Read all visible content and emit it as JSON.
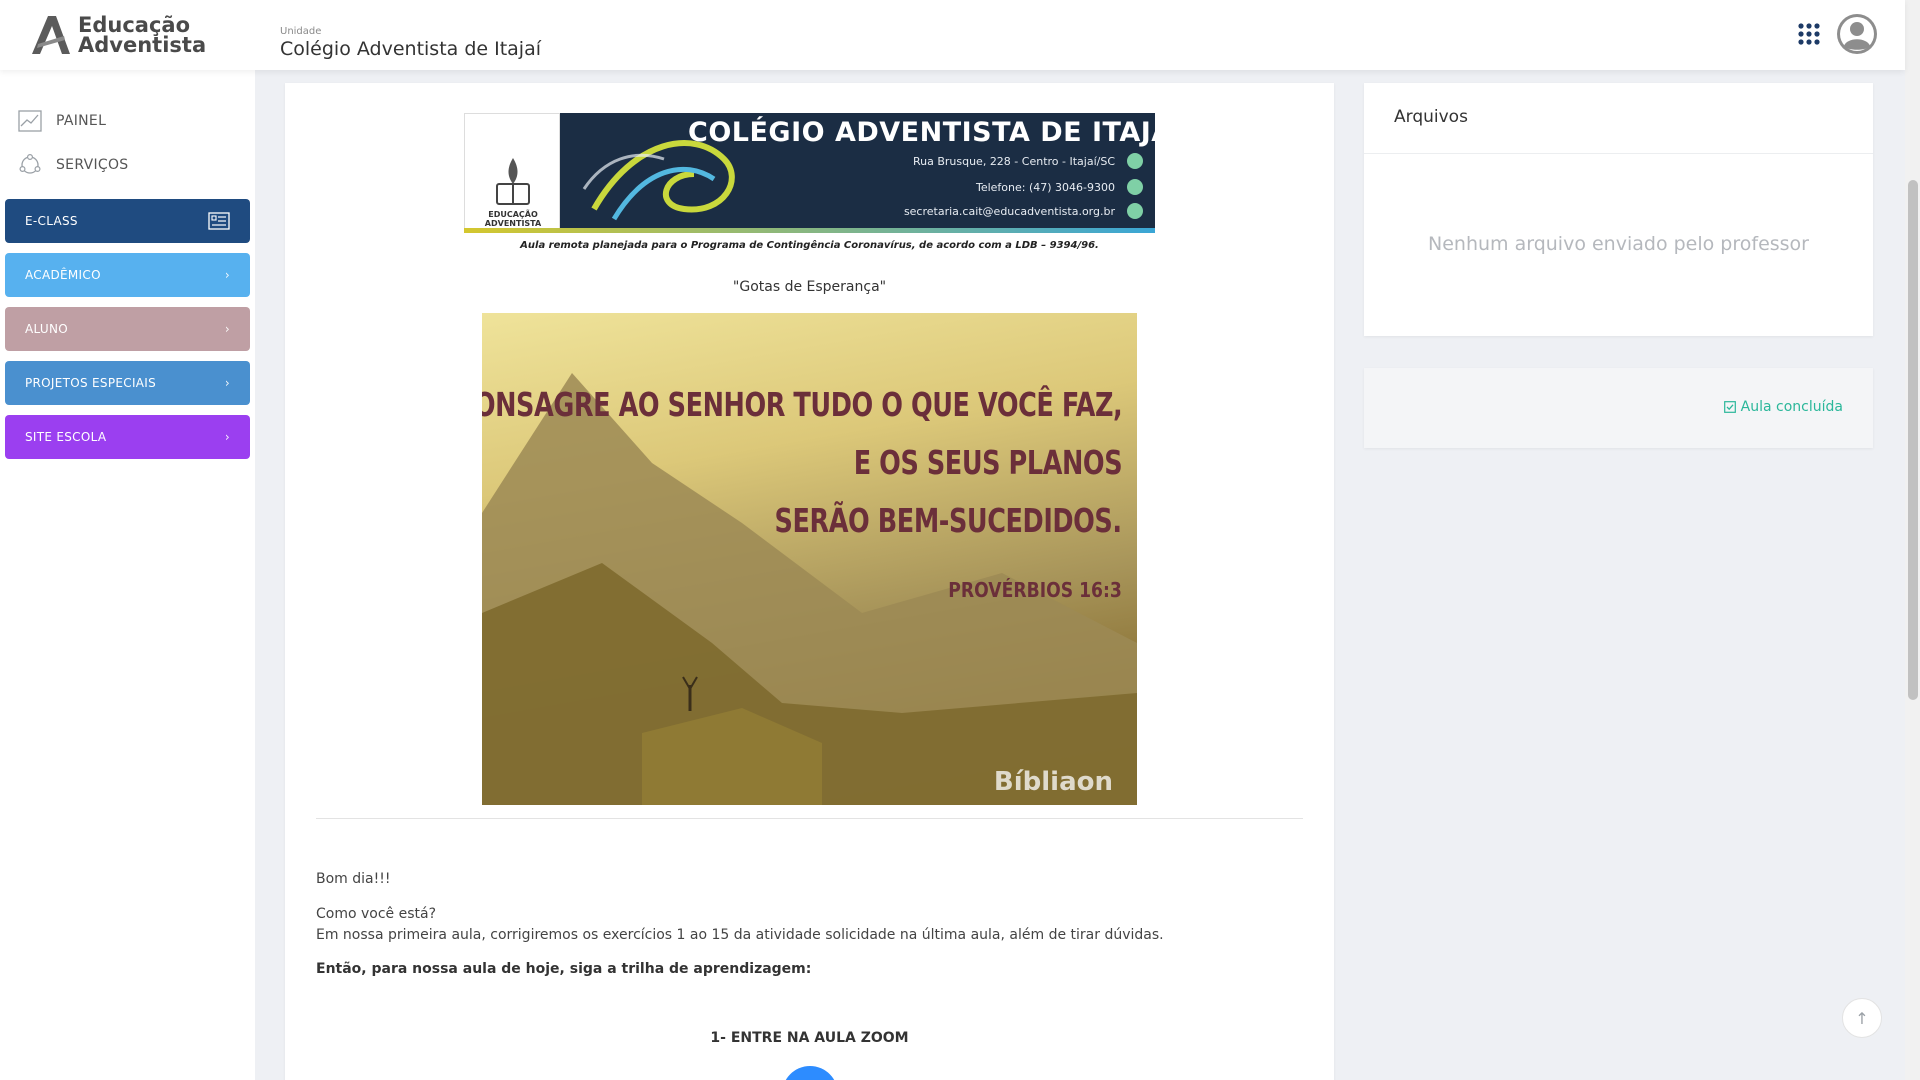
{
  "header": {
    "logo_line1": "Educação",
    "logo_line2": "Adventista",
    "unit_label": "Unidade",
    "unit_name": "Colégio Adventista de Itajaí"
  },
  "sidebar": {
    "links": [
      {
        "label": "PAINEL",
        "icon": "chart-icon"
      },
      {
        "label": "SERVIÇOS",
        "icon": "services-icon"
      }
    ],
    "buttons": [
      {
        "label": "E-CLASS",
        "color": "#1f4b80",
        "icon": "list-card-icon"
      },
      {
        "label": "ACADÊMICO",
        "color": "#57b1ef",
        "icon": "chevron-right-icon"
      },
      {
        "label": "ALUNO",
        "color": "#bf9fa4",
        "icon": "chevron-right-icon"
      },
      {
        "label": "PROJETOS ESPECIAIS",
        "color": "#4a90cf",
        "icon": "chevron-right-icon"
      },
      {
        "label": "SITE ESCOLA",
        "color": "#9b3ff0",
        "icon": "chevron-right-icon"
      }
    ]
  },
  "main": {
    "banner": {
      "title": "COLÉGIO ADVENTISTA DE ITAJAÍ",
      "address": "Rua Brusque, 228 - Centro - Itajaí/SC",
      "phone": "Telefone: (47) 3046-9300",
      "email": "secretaria.cait@educadventista.org.br",
      "logo_text": "EDUCAÇÃO ADVENTISTA"
    },
    "caption": "Aula remota planejada para o Programa de Contingência Coronavírus, de acordo com a LDB – 9394/96.",
    "subtitle": "\"Gotas de Esperança\"",
    "verse": {
      "line1": "CONSAGRE AO SENHOR TUDO O QUE VOCÊ FAZ,",
      "line2": "E OS SEUS PLANOS",
      "line3": "SERÃO BEM-SUCEDIDOS.",
      "reference": "PROVÉRBIOS 16:3",
      "watermark": "Bíbliaon"
    },
    "greeting": "Bom dia!!!",
    "question": "Como você está?",
    "intro": "Em nossa primeira aula, corrigiremos os exercícios 1 ao 15 da atividade solicidade na última aula, além de tirar dúvidas.",
    "trail": "Então, para nossa aula de hoje, siga a trilha de aprendizagem:",
    "step1": "1- ENTRE NA AULA ZOOM"
  },
  "files": {
    "title": "Arquivos",
    "empty": "Nenhum arquivo enviado pelo professor"
  },
  "done": {
    "label": "Aula concluída",
    "color": "#2bb79a"
  }
}
